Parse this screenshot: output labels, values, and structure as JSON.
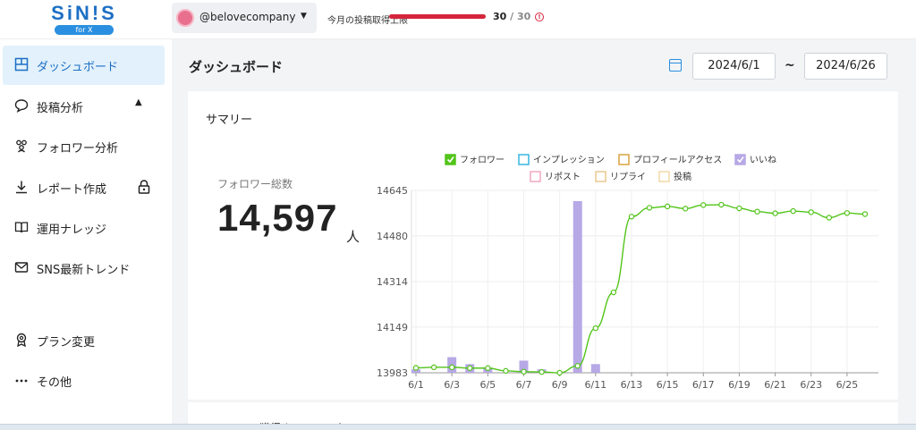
{
  "header": {
    "logo_text": "SiN!S",
    "logo_badge": "for X",
    "account": "@belovecompany",
    "limit_label": "今月の投稿取得上限",
    "limit_used": "30",
    "limit_sep": "/",
    "limit_total": "30",
    "limit_fraction": 1.0,
    "accent_color": "#d5253b"
  },
  "sidebar": {
    "items": [
      {
        "label": "ダッシュボード",
        "icon": "dashboard-icon",
        "active": true
      },
      {
        "label": "投稿分析",
        "icon": "speech-bubble-icon",
        "extra": "▲"
      },
      {
        "label": "フォロワー分析",
        "icon": "people-icon"
      },
      {
        "label": "レポート作成",
        "icon": "download-icon",
        "extra": "lock-icon"
      },
      {
        "label": "運用ナレッジ",
        "icon": "book-icon"
      },
      {
        "label": "SNS最新トレンド",
        "icon": "mail-icon"
      },
      {
        "label": "プラン変更",
        "icon": "badge-icon"
      },
      {
        "label": "その他",
        "icon": "more-icon"
      }
    ]
  },
  "main": {
    "title": "ダッシュボード",
    "date_from": "2024/6/1",
    "date_sep": "~",
    "date_to": "2024/6/26",
    "summary_title": "サマリー",
    "stat_label": "フォロワー総数",
    "stat_value": "14,597",
    "stat_unit": "人",
    "next_card_title": "フォロワー獲得までのファネル"
  },
  "chart_data": {
    "type": "line",
    "legend": [
      {
        "name": "フォロワー",
        "color": "#52c41a",
        "checked": true
      },
      {
        "name": "インプレッション",
        "color": "#36b7e0",
        "checked": false
      },
      {
        "name": "プロフィールアクセス",
        "color": "#d9a441",
        "checked": false
      },
      {
        "name": "いいね",
        "color": "#b7a8e6",
        "checked": true
      },
      {
        "name": "リポスト",
        "color": "#f2a7c3",
        "checked": false
      },
      {
        "name": "リプライ",
        "color": "#e8c98f",
        "checked": false
      },
      {
        "name": "投稿",
        "color": "#f3d9a8",
        "checked": false
      }
    ],
    "x": [
      "6/1",
      "6/2",
      "6/3",
      "6/4",
      "6/5",
      "6/6",
      "6/7",
      "6/8",
      "6/9",
      "6/10",
      "6/11",
      "6/12",
      "6/13",
      "6/14",
      "6/15",
      "6/16",
      "6/17",
      "6/18",
      "6/19",
      "6/20",
      "6/21",
      "6/22",
      "6/23",
      "6/24",
      "6/25",
      "6/26"
    ],
    "x_tick_labels": [
      "6/1",
      "6/3",
      "6/5",
      "6/7",
      "6/9",
      "6/11",
      "6/13",
      "6/15",
      "6/17",
      "6/19",
      "6/21",
      "6/23",
      "6/25"
    ],
    "y_ticks": [
      "14645",
      "14480",
      "14314",
      "14149",
      "13983"
    ],
    "ylim": [
      13983,
      14645
    ],
    "series": [
      {
        "name": "フォロワー",
        "type": "line",
        "values": [
          14001,
          14003,
          14003,
          14000,
          14000,
          13990,
          13987,
          13986,
          13983,
          14008,
          14145,
          14275,
          14550,
          14582,
          14587,
          14579,
          14592,
          14593,
          14580,
          14568,
          14562,
          14570,
          14566,
          14546,
          14563,
          14559
        ]
      },
      {
        "name": "いいね",
        "type": "bar",
        "relative_values": [
          0.02,
          0,
          0.09,
          0.05,
          0.03,
          0,
          0.07,
          0.02,
          0,
          0.99,
          0.05,
          0,
          0,
          0,
          0,
          0,
          0,
          0,
          0,
          0,
          0,
          0,
          0,
          0,
          0,
          0
        ]
      }
    ]
  }
}
